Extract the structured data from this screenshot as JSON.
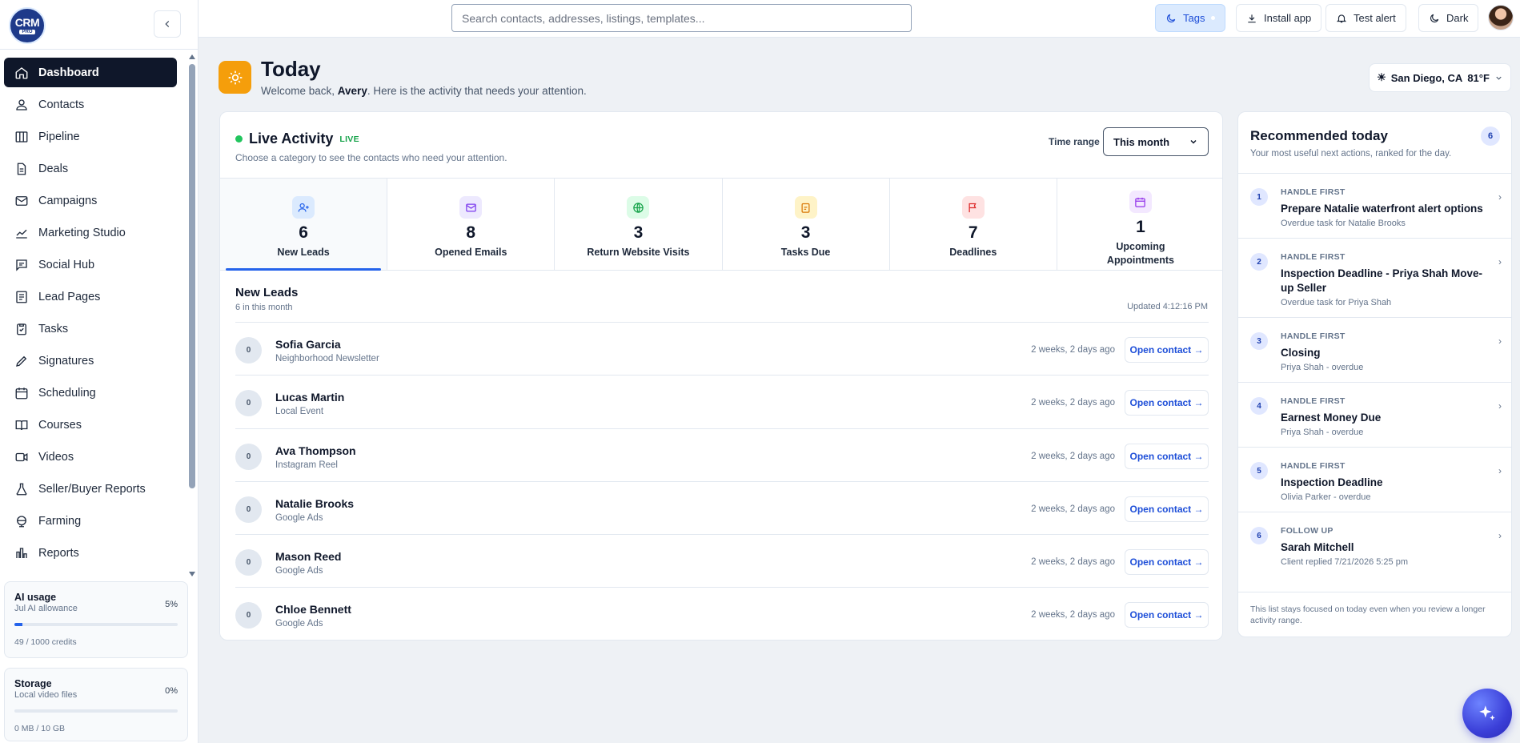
{
  "brand": {
    "logo_text": "CRM",
    "logo_sub": "PRO"
  },
  "sidebar": {
    "items": [
      {
        "label": "Dashboard",
        "icon": "home-icon"
      },
      {
        "label": "Contacts",
        "icon": "users-icon"
      },
      {
        "label": "Pipeline",
        "icon": "columns-icon"
      },
      {
        "label": "Deals",
        "icon": "file-icon"
      },
      {
        "label": "Campaigns",
        "icon": "mail-icon"
      },
      {
        "label": "Marketing Studio",
        "icon": "chart-icon"
      },
      {
        "label": "Social Hub",
        "icon": "message-icon"
      },
      {
        "label": "Lead Pages",
        "icon": "page-icon"
      },
      {
        "label": "Tasks",
        "icon": "clipboard-icon"
      },
      {
        "label": "Signatures",
        "icon": "pen-icon"
      },
      {
        "label": "Scheduling",
        "icon": "calendar-icon"
      },
      {
        "label": "Courses",
        "icon": "book-icon"
      },
      {
        "label": "Videos",
        "icon": "video-icon"
      },
      {
        "label": "Seller/Buyer Reports",
        "icon": "flask-icon"
      },
      {
        "label": "Farming",
        "icon": "globe-icon"
      },
      {
        "label": "Reports",
        "icon": "bar-chart-icon"
      }
    ],
    "ai_usage": {
      "title": "AI usage",
      "sub": "Jul AI allowance",
      "percent_label": "5%",
      "percent": 5,
      "credits": "49 / 1000 credits"
    },
    "storage": {
      "title": "Storage",
      "sub": "Local video files",
      "percent_label": "0%",
      "percent": 0,
      "credits": "0 MB / 10 GB"
    }
  },
  "topbar": {
    "search_placeholder": "Search contacts, addresses, listings, templates...",
    "tags": "Tags",
    "install": "Install app",
    "test_alert": "Test alert",
    "dark": "Dark"
  },
  "header": {
    "title": "Today",
    "welcome_prefix": "Welcome back, ",
    "user": "Avery",
    "welcome_suffix": ". Here is the activity that needs your attention.",
    "weather": "San Diego, CA",
    "temp": "81°F"
  },
  "activity": {
    "title": "Live Activity",
    "badge": "LIVE",
    "sub": "Choose a category to see the contacts who need your attention.",
    "range_label": "Time range",
    "range_value": "This month",
    "categories": [
      {
        "count": "6",
        "label": "New Leads",
        "color": "#dbeafe",
        "stroke": "#2563eb"
      },
      {
        "count": "8",
        "label": "Opened Emails",
        "color": "#ede9fe",
        "stroke": "#7c3aed"
      },
      {
        "count": "3",
        "label": "Return Website Visits",
        "color": "#dcfce7",
        "stroke": "#16a34a"
      },
      {
        "count": "3",
        "label": "Tasks Due",
        "color": "#fef3c7",
        "stroke": "#d97706"
      },
      {
        "count": "7",
        "label": "Deadlines",
        "color": "#fee2e2",
        "stroke": "#dc2626"
      },
      {
        "count": "1",
        "label": "Upcoming Appointments",
        "color": "#f3e8ff",
        "stroke": "#9333ea"
      }
    ],
    "list_title": "New Leads",
    "list_sub": "6 in this month",
    "updated": "Updated 4:12:16 PM",
    "open_label": "Open contact →",
    "leads": [
      {
        "num": "0",
        "name": "Sofia Garcia",
        "source": "Neighborhood Newsletter",
        "when": "2 weeks, 2 days ago"
      },
      {
        "num": "0",
        "name": "Lucas Martin",
        "source": "Local Event",
        "when": "2 weeks, 2 days ago"
      },
      {
        "num": "0",
        "name": "Ava Thompson",
        "source": "Instagram Reel",
        "when": "2 weeks, 2 days ago"
      },
      {
        "num": "0",
        "name": "Natalie Brooks",
        "source": "Google Ads",
        "when": "2 weeks, 2 days ago"
      },
      {
        "num": "0",
        "name": "Mason Reed",
        "source": "Google Ads",
        "when": "2 weeks, 2 days ago"
      },
      {
        "num": "0",
        "name": "Chloe Bennett",
        "source": "Google Ads",
        "when": "2 weeks, 2 days ago"
      }
    ]
  },
  "recommended": {
    "title": "Recommended today",
    "sub": "Your most useful next actions, ranked for the day.",
    "count": "6",
    "items": [
      {
        "idx": "1",
        "kicker": "HANDLE FIRST",
        "title": "Prepare Natalie waterfront alert options",
        "sub": "Overdue task for Natalie Brooks"
      },
      {
        "idx": "2",
        "kicker": "HANDLE FIRST",
        "title": "Inspection Deadline - Priya Shah Move-up Seller",
        "sub": "Overdue task for Priya Shah"
      },
      {
        "idx": "3",
        "kicker": "HANDLE FIRST",
        "title": "Closing",
        "sub": "Priya Shah - overdue"
      },
      {
        "idx": "4",
        "kicker": "HANDLE FIRST",
        "title": "Earnest Money Due",
        "sub": "Priya Shah - overdue"
      },
      {
        "idx": "5",
        "kicker": "HANDLE FIRST",
        "title": "Inspection Deadline",
        "sub": "Olivia Parker - overdue"
      },
      {
        "idx": "6",
        "kicker": "FOLLOW UP",
        "title": "Sarah Mitchell",
        "sub": "Client replied 7/21/2026 5:25 pm"
      }
    ],
    "footer": "This list stays focused on today even when you review a longer activity range."
  }
}
